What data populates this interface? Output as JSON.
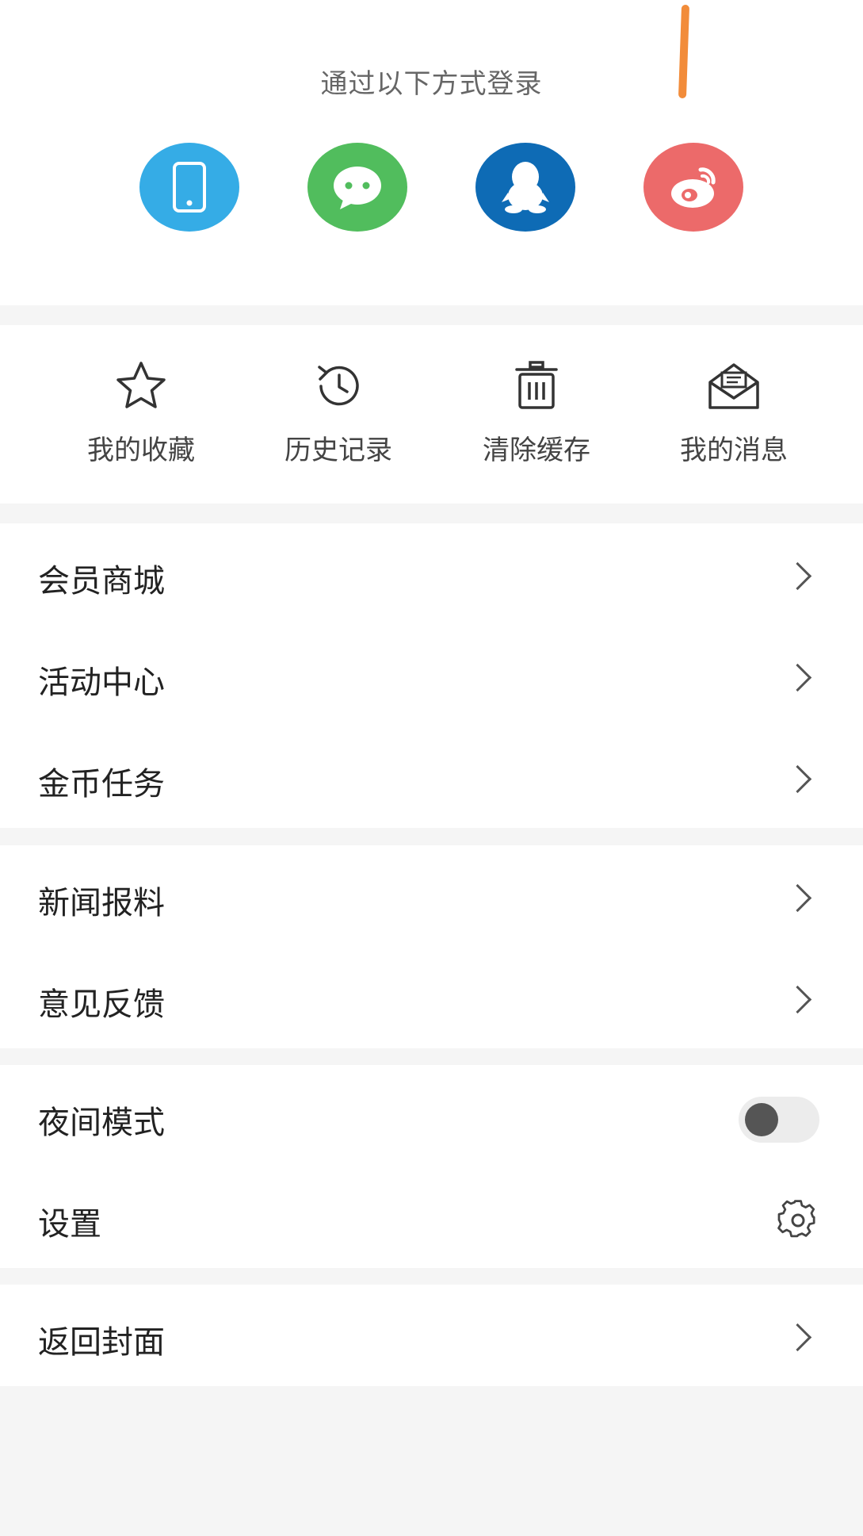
{
  "login": {
    "title": "通过以下方式登录",
    "methods": [
      {
        "name": "phone",
        "color": "#35ACE6"
      },
      {
        "name": "wechat",
        "color": "#51BD5D"
      },
      {
        "name": "qq",
        "color": "#0E6BB5"
      },
      {
        "name": "weibo",
        "color": "#EC6A6A"
      }
    ],
    "accent_mark_color": "#F28C3A"
  },
  "quick_actions": [
    {
      "label": "我的收藏",
      "icon": "star-icon"
    },
    {
      "label": "历史记录",
      "icon": "history-icon"
    },
    {
      "label": "清除缓存",
      "icon": "trash-icon"
    },
    {
      "label": "我的消息",
      "icon": "mail-icon"
    }
  ],
  "menu": {
    "group1": [
      {
        "label": "会员商城"
      },
      {
        "label": "活动中心"
      },
      {
        "label": "金币任务"
      }
    ],
    "group2": [
      {
        "label": "新闻报料"
      },
      {
        "label": "意见反馈"
      }
    ],
    "group3": {
      "night_mode_label": "夜间模式",
      "night_mode_on": false,
      "settings_label": "设置"
    },
    "group4": [
      {
        "label": "返回封面"
      }
    ]
  }
}
